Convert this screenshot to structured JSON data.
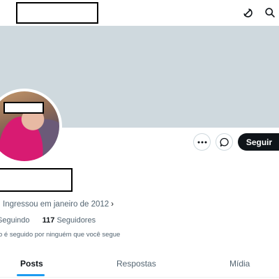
{
  "header": {
    "icons": [
      "grok-icon",
      "search-icon"
    ]
  },
  "profile": {
    "follow_label": "Seguir",
    "joined_text": "Ingressou em janeiro de 2012",
    "joined_chevron": "›",
    "following_label": "Seguindo",
    "followers_count": "117",
    "followers_label": "Seguidores",
    "followed_note": "o é seguido por ninguém que você segue"
  },
  "tabs": [
    {
      "label": "Posts",
      "active": true
    },
    {
      "label": "Respostas",
      "active": false
    },
    {
      "label": "Mídia",
      "active": false
    }
  ],
  "colors": {
    "banner": "#cfd9de",
    "accent": "#1d9bf0",
    "text_primary": "#0f1419",
    "text_secondary": "#536471",
    "follow_button_bg": "#0f1419"
  }
}
